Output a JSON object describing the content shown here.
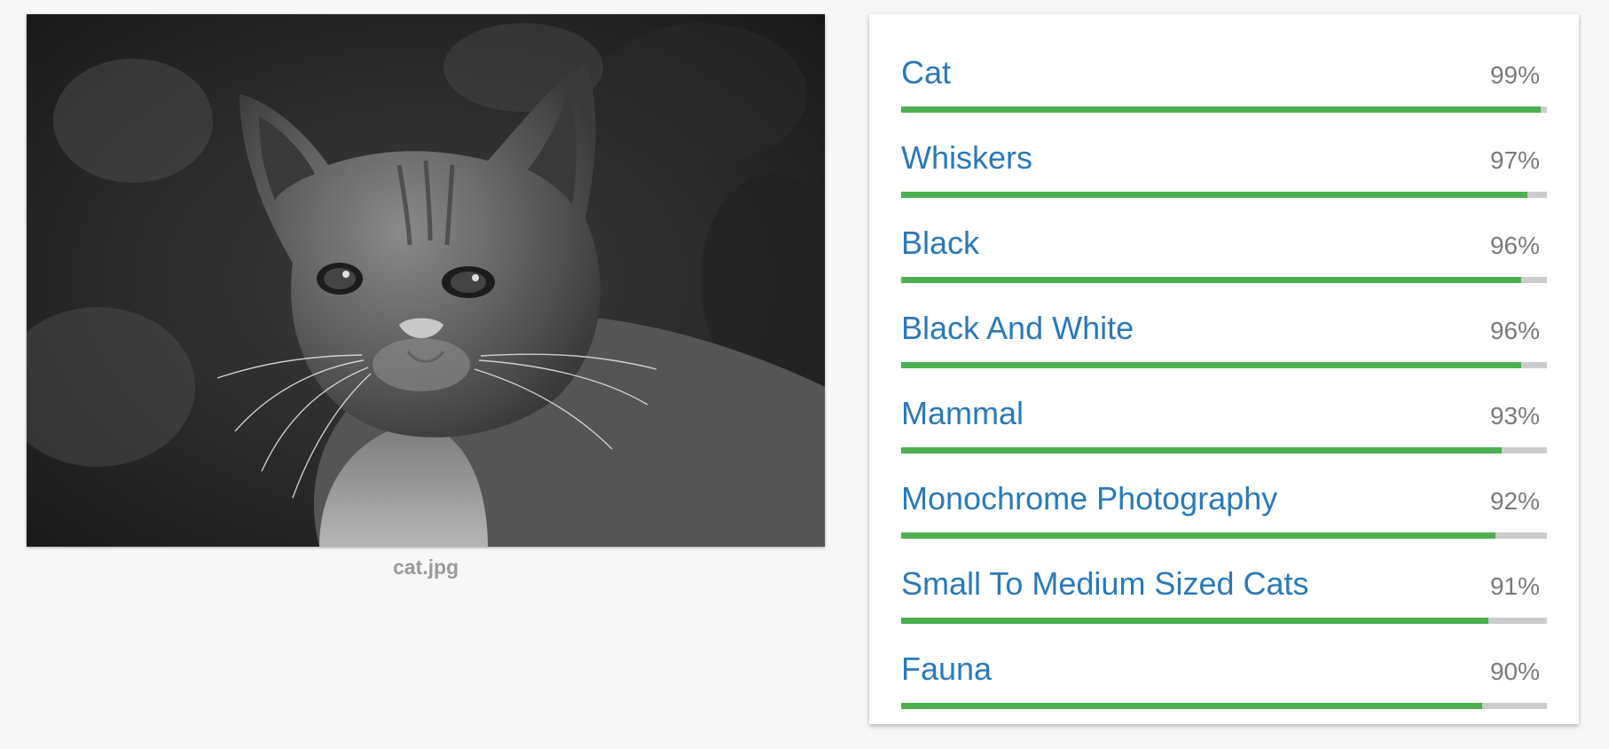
{
  "image": {
    "filename": "cat.jpg"
  },
  "labels": [
    {
      "name": "Cat",
      "score_text": "99%",
      "score": 0.99
    },
    {
      "name": "Whiskers",
      "score_text": "97%",
      "score": 0.97
    },
    {
      "name": "Black",
      "score_text": "96%",
      "score": 0.96
    },
    {
      "name": "Black And White",
      "score_text": "96%",
      "score": 0.96
    },
    {
      "name": "Mammal",
      "score_text": "93%",
      "score": 0.93
    },
    {
      "name": "Monochrome Photography",
      "score_text": "92%",
      "score": 0.92
    },
    {
      "name": "Small To Medium Sized Cats",
      "score_text": "91%",
      "score": 0.91
    },
    {
      "name": "Fauna",
      "score_text": "90%",
      "score": 0.9
    }
  ],
  "colors": {
    "label_text": "#2a79b8",
    "bar_fill": "#4caf50",
    "bar_track": "#cccccc",
    "score_text": "#7a7a7a",
    "background": "#f7f7f7"
  }
}
